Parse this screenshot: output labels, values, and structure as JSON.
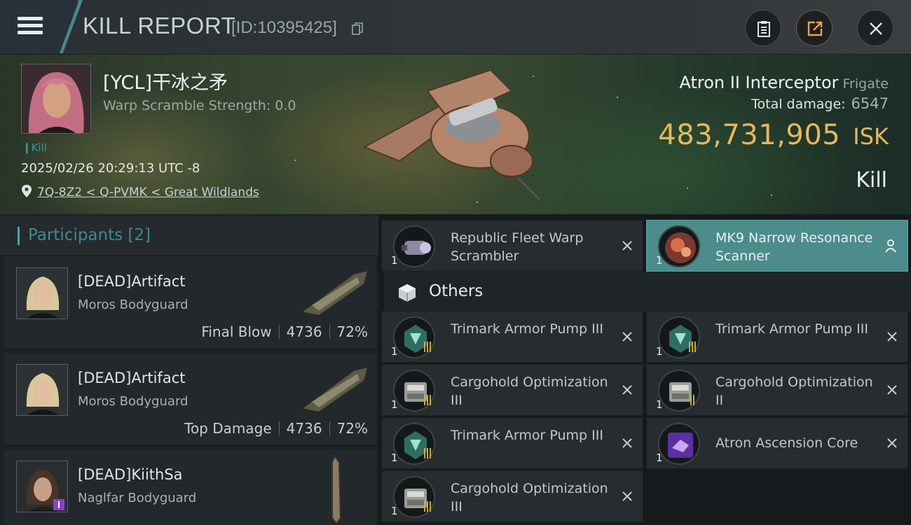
{
  "header": {
    "title": "KILL REPORT",
    "report_id": "[ID:10395425]"
  },
  "victim": {
    "name": "[YCL]干冰之矛",
    "warp_scramble": "Warp Scramble Strength: 0.0",
    "tag": "Kill",
    "datetime": "2025/02/26 20:29:13 UTC -8",
    "location": "7Q-8Z2 < Q-PVMK < Great Wildlands"
  },
  "ship": {
    "name": "Atron II Interceptor",
    "class": "Frigate",
    "total_damage_label": "Total damage:",
    "total_damage": "6547",
    "isk_value": "483,731,905",
    "isk_unit": "ISK",
    "result": "Kill"
  },
  "participants": {
    "label": "Participants [2]",
    "rows": [
      {
        "name": "[DEAD]Artifact",
        "ship": "Moros Bodyguard",
        "role": "Final Blow",
        "damage": "4736",
        "percent": "72%"
      },
      {
        "name": "[DEAD]Artifact",
        "ship": "Moros Bodyguard",
        "role": "Top Damage",
        "damage": "4736",
        "percent": "72%"
      },
      {
        "name": "[DEAD]KiithSa",
        "ship": "Naglfar Bodyguard"
      }
    ]
  },
  "modules": {
    "top": [
      {
        "qty": "1",
        "name": "Republic Fleet Warp Scrambler",
        "icon": "warp-scrambler-icon"
      },
      {
        "qty": "1",
        "name": "MK9 Narrow Resonance Scanner",
        "icon": "scanner-icon",
        "highlighted": true
      }
    ],
    "others_label": "Others",
    "others": [
      {
        "qty": "1",
        "name": "Trimark Armor Pump III",
        "icon": "armor-pump-icon",
        "tier": 3
      },
      {
        "qty": "1",
        "name": "Trimark Armor Pump III",
        "icon": "armor-pump-icon",
        "tier": 3
      },
      {
        "qty": "1",
        "name": "Cargohold Optimization III",
        "icon": "cargohold-icon",
        "tier": 3
      },
      {
        "qty": "1",
        "name": "Cargohold Optimization II",
        "icon": "cargohold-icon",
        "tier": 2
      },
      {
        "qty": "1",
        "name": "Trimark Armor Pump III",
        "icon": "armor-pump-icon",
        "tier": 3
      },
      {
        "qty": "1",
        "name": "Atron Ascension Core",
        "icon": "ascension-core-icon"
      },
      {
        "qty": "1",
        "name": "Cargohold Optimization III",
        "icon": "cargohold-icon",
        "tier": 3
      }
    ]
  },
  "colors": {
    "accent_teal": "#49a5ad",
    "isk_gold": "#e6b85f",
    "highlight_slot": "#4c8c8a"
  }
}
